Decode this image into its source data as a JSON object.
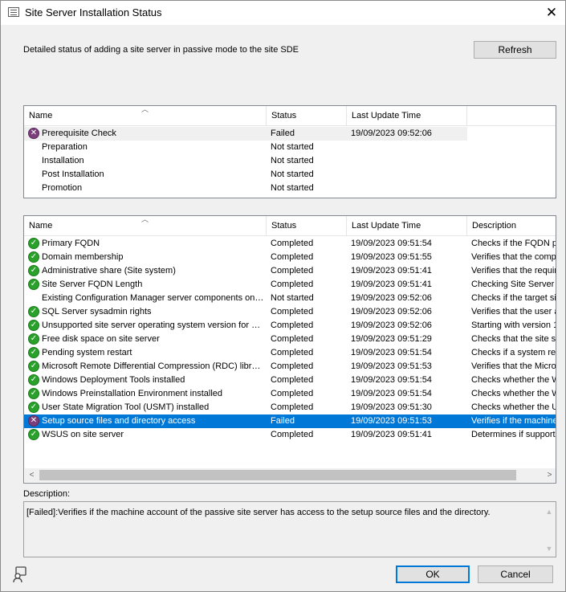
{
  "window": {
    "title": "Site Server Installation Status",
    "close_glyph": "✕"
  },
  "summary": "Detailed status of adding a site server in passive mode to the site SDE",
  "buttons": {
    "refresh": "Refresh",
    "ok": "OK",
    "cancel": "Cancel"
  },
  "stages": {
    "columns": [
      "Name",
      "Status",
      "Last Update Time"
    ],
    "rows": [
      {
        "icon": "failed-icon",
        "name": "Prerequisite Check",
        "status": "Failed",
        "time": "19/09/2023 09:52:06"
      },
      {
        "icon": "",
        "name": "Preparation",
        "status": "Not started",
        "time": ""
      },
      {
        "icon": "",
        "name": "Installation",
        "status": "Not started",
        "time": ""
      },
      {
        "icon": "",
        "name": "Post Installation",
        "status": "Not started",
        "time": ""
      },
      {
        "icon": "",
        "name": "Promotion",
        "status": "Not started",
        "time": ""
      }
    ]
  },
  "checks": {
    "columns": [
      "Name",
      "Status",
      "Last Update Time",
      "Description"
    ],
    "rows": [
      {
        "icon": "completed-icon",
        "name": "Primary FQDN",
        "status": "Completed",
        "time": "19/09/2023 09:51:54",
        "desc": "Checks if the FQDN p"
      },
      {
        "icon": "completed-icon",
        "name": "Domain membership",
        "status": "Completed",
        "time": "19/09/2023 09:51:55",
        "desc": "Verifies that the compu"
      },
      {
        "icon": "completed-icon",
        "name": "Administrative share (Site system)",
        "status": "Completed",
        "time": "19/09/2023 09:51:41",
        "desc": "Verifies that the require"
      },
      {
        "icon": "completed-icon",
        "name": "Site Server FQDN Length",
        "status": "Completed",
        "time": "19/09/2023 09:51:41",
        "desc": "Checking Site Server F"
      },
      {
        "icon": "",
        "name": "Existing Configuration Manager server components on sit...",
        "status": "Not started",
        "time": "19/09/2023 09:52:06",
        "desc": "Checks if the target sit"
      },
      {
        "icon": "completed-icon",
        "name": "SQL Server sysadmin rights",
        "status": "Completed",
        "time": "19/09/2023 09:52:06",
        "desc": "Verifies that the user a"
      },
      {
        "icon": "completed-icon",
        "name": "Unsupported site server operating system version for Set...",
        "status": "Completed",
        "time": "19/09/2023 09:52:06",
        "desc": "Starting with version 1"
      },
      {
        "icon": "completed-icon",
        "name": "Free disk space on site server",
        "status": "Completed",
        "time": "19/09/2023 09:51:29",
        "desc": "Checks that the site se"
      },
      {
        "icon": "completed-icon",
        "name": "Pending system restart",
        "status": "Completed",
        "time": "19/09/2023 09:51:54",
        "desc": "Checks if a system res"
      },
      {
        "icon": "completed-icon",
        "name": "Microsoft Remote Differential Compression (RDC) library r...",
        "status": "Completed",
        "time": "19/09/2023 09:51:53",
        "desc": "Verifies that the Micros"
      },
      {
        "icon": "completed-icon",
        "name": "Windows Deployment Tools installed",
        "status": "Completed",
        "time": "19/09/2023 09:51:54",
        "desc": "Checks whether the W"
      },
      {
        "icon": "completed-icon",
        "name": "Windows Preinstallation Environment installed",
        "status": "Completed",
        "time": "19/09/2023 09:51:54",
        "desc": "Checks whether the W"
      },
      {
        "icon": "completed-icon",
        "name": "User State Migration Tool (USMT) installed",
        "status": "Completed",
        "time": "19/09/2023 09:51:30",
        "desc": "Checks whether the U"
      },
      {
        "icon": "failed-icon",
        "name": "Setup source files and directory access",
        "status": "Failed",
        "time": "19/09/2023 09:51:53",
        "desc": "Verifies if the machine"
      },
      {
        "icon": "completed-icon",
        "name": "WSUS on site server",
        "status": "Completed",
        "time": "19/09/2023 09:51:41",
        "desc": "Determines if supporte"
      }
    ]
  },
  "description": {
    "label": "Description:",
    "text": "[Failed]:Verifies if the machine account of the passive site server has access to the setup source files and the directory."
  },
  "colors": {
    "selection": "#0078d7",
    "completed": "#2aa12a",
    "failed": "#7c3f7c"
  }
}
